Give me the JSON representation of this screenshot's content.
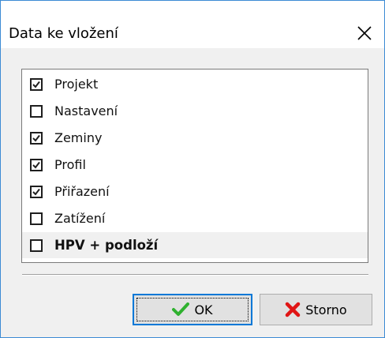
{
  "dialog": {
    "title": "Data ke vložení",
    "close_icon": "close-icon"
  },
  "items": [
    {
      "label": "Projekt",
      "checked": true,
      "bold": false
    },
    {
      "label": "Nastavení",
      "checked": false,
      "bold": false
    },
    {
      "label": "Zeminy",
      "checked": true,
      "bold": false
    },
    {
      "label": "Profil",
      "checked": true,
      "bold": false
    },
    {
      "label": "Přiřazení",
      "checked": true,
      "bold": false
    },
    {
      "label": "Zatížení",
      "checked": false,
      "bold": false
    },
    {
      "label": "HPV + podloží",
      "checked": false,
      "bold": true,
      "selected": true
    }
  ],
  "buttons": {
    "ok_label": "OK",
    "ok_icon": "checkmark-icon",
    "ok_icon_color": "#2fb12f",
    "cancel_label": "Storno",
    "cancel_icon": "red-x-icon",
    "cancel_icon_color": "#e01515"
  }
}
